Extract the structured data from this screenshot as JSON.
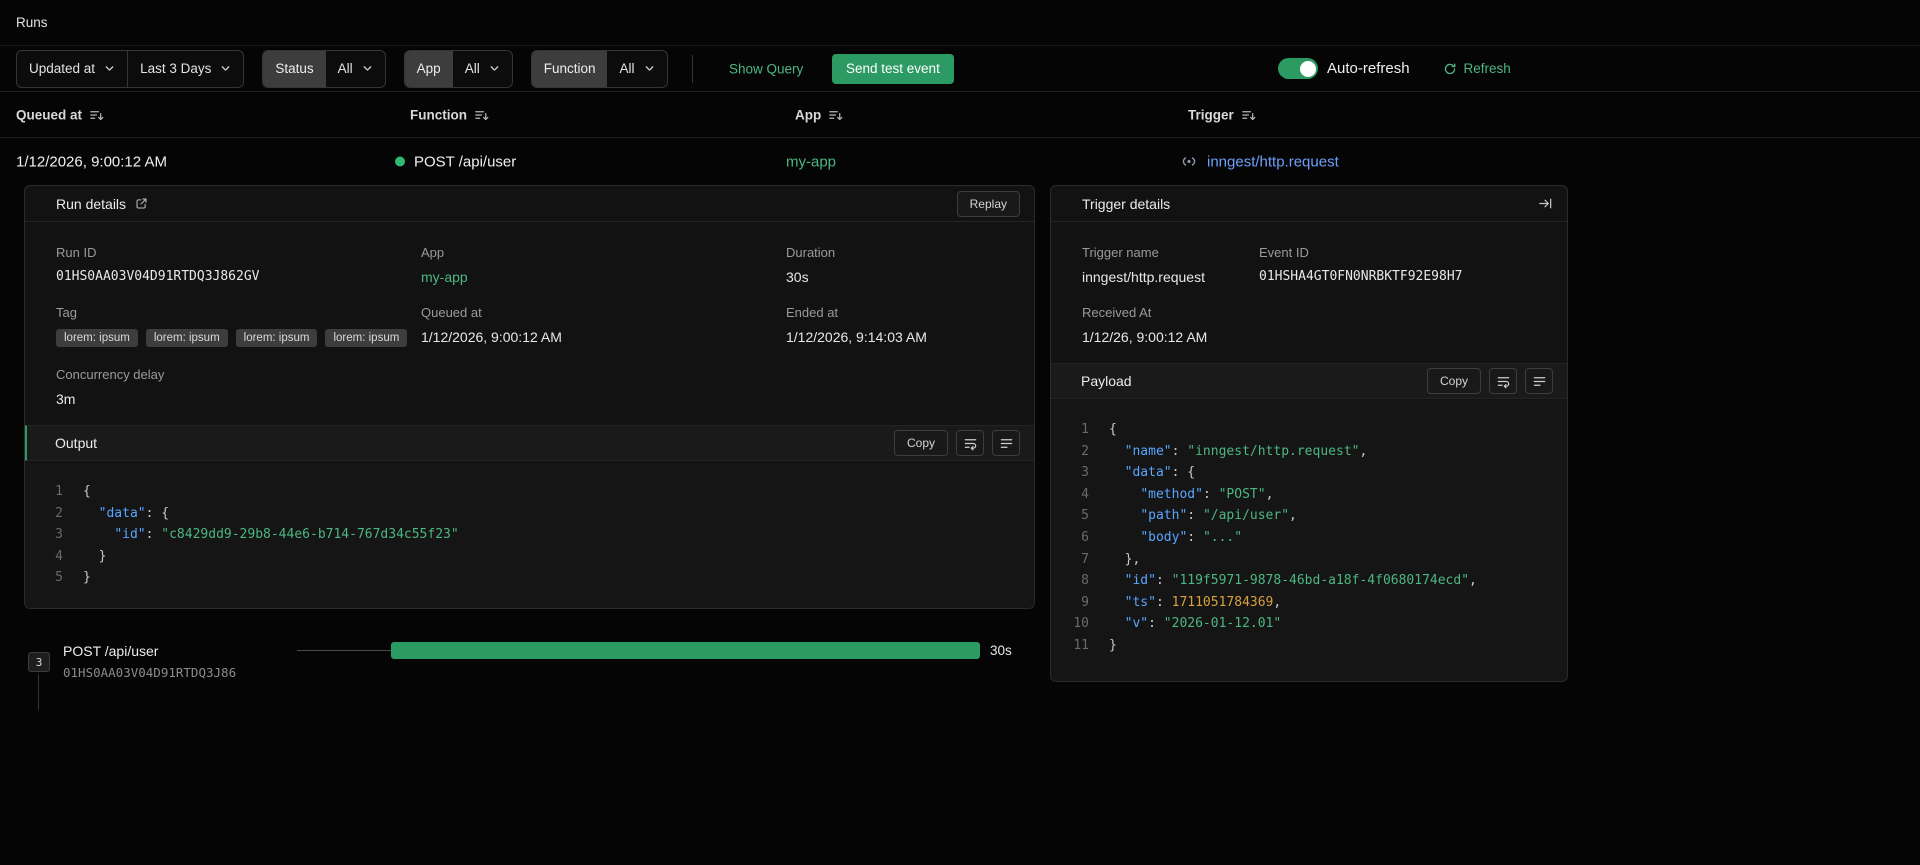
{
  "page": {
    "title": "Runs"
  },
  "filters": {
    "sort": {
      "label": "Updated at"
    },
    "range": {
      "label": "Last 3 Days"
    },
    "status": {
      "label": "Status",
      "value": "All"
    },
    "app": {
      "label": "App",
      "value": "All"
    },
    "function": {
      "label": "Function",
      "value": "All"
    },
    "show_query_label": "Show Query",
    "send_test_event_label": "Send test event",
    "auto_refresh_label": "Auto-refresh",
    "refresh_label": "Refresh"
  },
  "runs_table": {
    "columns": [
      "Queued at",
      "Function",
      "App",
      "Trigger"
    ],
    "row": {
      "queued_at": "1/12/2026, 9:00:12 AM",
      "function_name": "POST /api/user",
      "app": "my-app",
      "trigger": "inngest/http.request"
    }
  },
  "run_details": {
    "title": "Run details",
    "replay_label": "Replay",
    "run_id": {
      "label": "Run ID",
      "value": "01HS0AA03V04D91RTDQ3J862GV"
    },
    "app": {
      "label": "App",
      "value": "my-app"
    },
    "duration": {
      "label": "Duration",
      "value": "30s"
    },
    "tag": {
      "label": "Tag",
      "chips": [
        "lorem: ipsum",
        "lorem: ipsum",
        "lorem: ipsum",
        "lorem: ipsum"
      ]
    },
    "queued_at": {
      "label": "Queued at",
      "value": "1/12/2026, 9:00:12 AM"
    },
    "ended_at": {
      "label": "Ended at",
      "value": "1/12/2026, 9:14:03 AM"
    },
    "concurrency_delay": {
      "label": "Concurrency delay",
      "value": "3m"
    },
    "output": {
      "title": "Output",
      "copy_label": "Copy",
      "code_lines": [
        "{",
        "  \"data\": {",
        "    \"id\": \"c8429dd9-29b8-44e6-b714-767d34c55f23\"",
        "  }",
        "}"
      ]
    }
  },
  "trigger_details": {
    "title": "Trigger details",
    "trigger_name": {
      "label": "Trigger name",
      "value": "inngest/http.request"
    },
    "event_id": {
      "label": "Event ID",
      "value": "01HSHA4GT0FN0NRBKTF92E98H7"
    },
    "received_at": {
      "label": "Received At",
      "value": "1/12/26, 9:00:12 AM"
    },
    "payload": {
      "title": "Payload",
      "copy_label": "Copy",
      "code_lines": [
        "{",
        "  \"name\": \"inngest/http.request\",",
        "  \"data\": {",
        "    \"method\": \"POST\",",
        "    \"path\": \"/api/user\",",
        "    \"body\": \"...\"",
        "  },",
        "  \"id\": \"119f5971-9878-46bd-a18f-4f0680174ecd\",",
        "  \"ts\": 1711051784369,",
        "  \"v\": \"2026-01-12.01\"",
        "}"
      ]
    }
  },
  "trace": {
    "step_count": "3",
    "step_name": "POST /api/user",
    "step_id": "01HS0AA03V04D91RTDQ3J86",
    "duration": "30s"
  },
  "colors": {
    "accent_green": "#2c9b63",
    "status_dot_green": "#2fb873",
    "link_green": "#4cb782",
    "link_blue": "#6d9ff9",
    "code_key": "#58a6ff",
    "code_string": "#4cb782",
    "code_number": "#d7a13d"
  },
  "icons": {
    "chevron_down": "chevron-down",
    "sort_column": "bars-arrow-down",
    "refresh": "circular-arrow",
    "external_link": "arrow-out-of-box",
    "event_trigger": "radio-waves",
    "status_dot": "filled-circle",
    "wrap_text": "wrap-lines",
    "format_text": "horizontal-lines",
    "collapse_panel": "arrow-right-to-bar",
    "auto_refresh_toggle": "switch-on"
  }
}
